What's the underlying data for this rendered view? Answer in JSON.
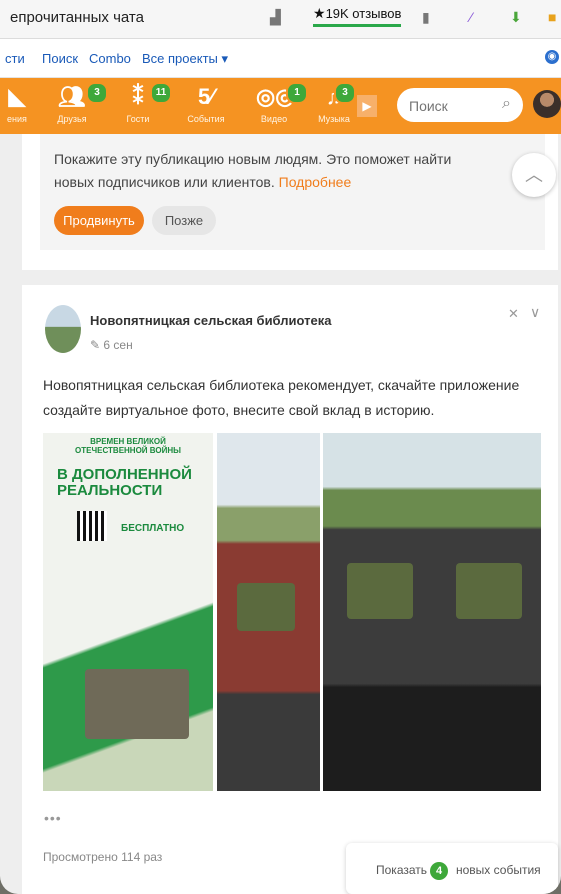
{
  "browser": {
    "tab_title": "епрочитанных чата",
    "rating": "19K отзывов"
  },
  "linkbar": {
    "items": [
      "сти",
      "Поиск",
      "Combo",
      "Все проекты ▾"
    ]
  },
  "nav": {
    "items": [
      {
        "label": "ения",
        "badge": ""
      },
      {
        "label": "Друзья",
        "badge": "3"
      },
      {
        "label": "Гости",
        "badge": "11"
      },
      {
        "label": "События",
        "badge": ""
      },
      {
        "label": "Видео",
        "badge": "1"
      },
      {
        "label": "Музыка",
        "badge": "3"
      }
    ],
    "search_placeholder": "Поиск"
  },
  "promo": {
    "text": "Покажите эту публикацию новым людям. Это поможет найти новых подписчиков или клиентов.",
    "link": "Подробнее",
    "promote_button": "Продвинуть",
    "later_button": "Позже"
  },
  "post": {
    "author": "Новопятницкая сельская библиотека",
    "time": "6 сен",
    "text": "Новопятницкая сельская библиотека рекомендует, скачайте приложение  создайте виртуальное фото, внесите свой вклад в историю.",
    "photo1_header": "ВРЕМЕН ВЕЛИКОЙ ОТЕЧЕСТВЕННОЙ ВОЙНЫ",
    "photo1_title": "В ДОПОЛНЕННОЙ РЕАЛЬНОСТИ",
    "photo1_free": "БЕСПЛАТНО",
    "more_dots": "•••",
    "views": "Просмотрено 114 раз"
  },
  "events": {
    "prefix": "Показать",
    "count": "4",
    "suffix": "новых события"
  }
}
